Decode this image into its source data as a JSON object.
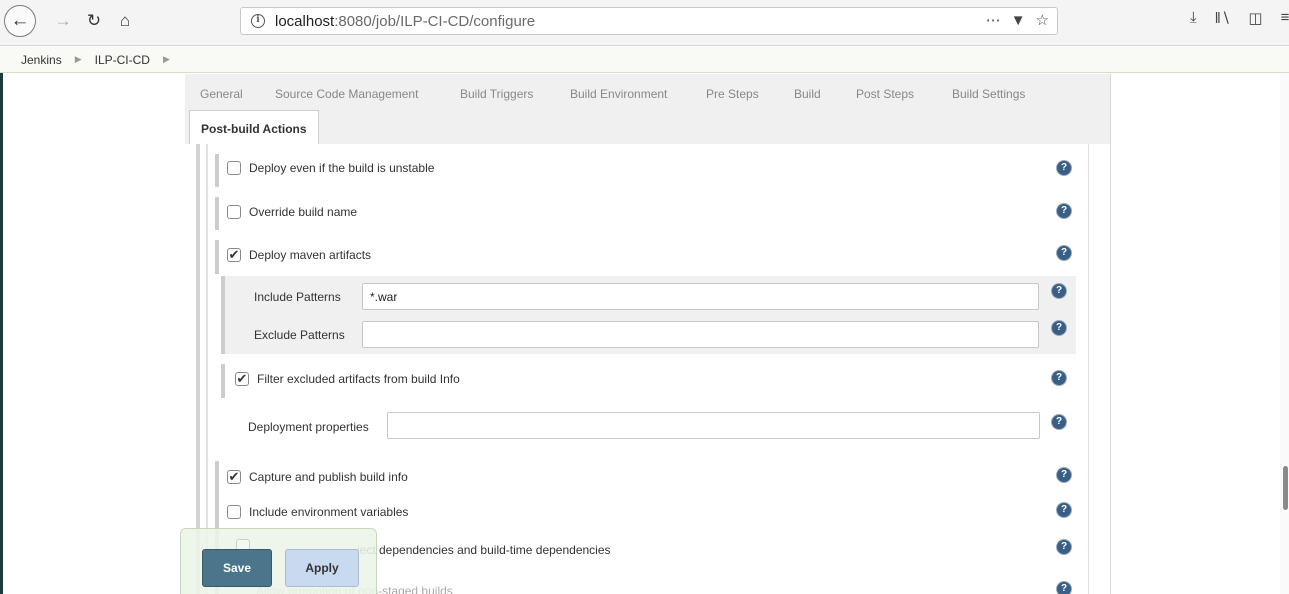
{
  "browser": {
    "url_host": "localhost",
    "url_path": ":8080/job/ILP-CI-CD/configure",
    "icons": [
      "back-icon",
      "forward-icon",
      "reload-icon",
      "home-icon",
      "info-icon",
      "more-icon",
      "pocket-icon",
      "star-icon",
      "download-icon",
      "library-icon",
      "sidebar-icon",
      "menu-icon"
    ]
  },
  "breadcrumb": {
    "items": [
      "Jenkins",
      "ILP-CI-CD"
    ]
  },
  "tabs": {
    "items": [
      "General",
      "Source Code Management",
      "Build Triggers",
      "Build Environment",
      "Pre Steps",
      "Build",
      "Post Steps",
      "Build Settings"
    ],
    "active": "Post-build Actions"
  },
  "options": {
    "deploy_unstable": {
      "label": "Deploy even if the build is unstable",
      "checked": false
    },
    "override_name": {
      "label": "Override build name",
      "checked": false
    },
    "deploy_maven": {
      "label": "Deploy maven artifacts",
      "checked": true
    },
    "include_patterns": {
      "label": "Include Patterns",
      "value": "*.war"
    },
    "exclude_patterns": {
      "label": "Exclude Patterns",
      "value": ""
    },
    "filter_excluded": {
      "label": "Filter excluded artifacts from build Info",
      "checked": true
    },
    "deployment_props": {
      "label": "Deployment properties",
      "value": ""
    },
    "capture_publish": {
      "label": "Capture and publish build info",
      "checked": true
    },
    "include_env": {
      "label": "Include environment variables",
      "checked": false
    },
    "record_deps": {
      "label": "ject dependencies and build-time dependencies",
      "checked": false
    },
    "allow_promotion": {
      "label": "Allow promotion of non-staged builds",
      "checked": false
    }
  },
  "buttons": {
    "save": "Save",
    "apply": "Apply"
  },
  "help_glyph": "?",
  "check_glyph": "✔"
}
